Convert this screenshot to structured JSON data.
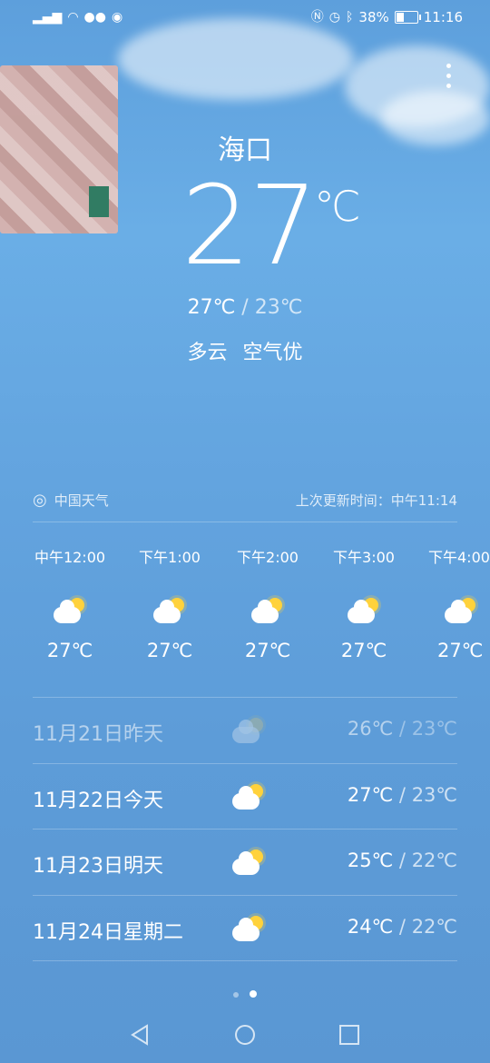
{
  "status_bar": {
    "battery": "38%",
    "time": "11:16",
    "battery_level": 0.38
  },
  "current": {
    "city": "海口",
    "temperature": "27",
    "unit": "℃",
    "high": "27℃",
    "low": "23℃",
    "separator": "/",
    "condition": "多云",
    "air_quality": "空气优"
  },
  "source": {
    "provider": "中国天气",
    "updated": "上次更新时间：中午11:14"
  },
  "hourly": [
    {
      "time": "中午12:00",
      "temp": "27℃",
      "icon": "partly-cloudy-icon"
    },
    {
      "time": "下午1:00",
      "temp": "27℃",
      "icon": "partly-cloudy-icon"
    },
    {
      "time": "下午2:00",
      "temp": "27℃",
      "icon": "partly-cloudy-icon"
    },
    {
      "time": "下午3:00",
      "temp": "27℃",
      "icon": "partly-cloudy-icon"
    },
    {
      "time": "下午4:00",
      "temp": "27℃",
      "icon": "partly-cloudy-icon"
    }
  ],
  "daily": [
    {
      "date": "11月21日昨天",
      "high": "26℃",
      "low": "23℃",
      "icon": "partly-cloudy-icon"
    },
    {
      "date": "11月22日今天",
      "high": "27℃",
      "low": "23℃",
      "icon": "partly-cloudy-icon"
    },
    {
      "date": "11月23日明天",
      "high": "25℃",
      "low": "22℃",
      "icon": "partly-cloudy-icon"
    },
    {
      "date": "11月24日星期二",
      "high": "24℃",
      "low": "22℃",
      "icon": "partly-cloudy-icon"
    }
  ],
  "pager": {
    "pages": 2,
    "active": 2
  }
}
